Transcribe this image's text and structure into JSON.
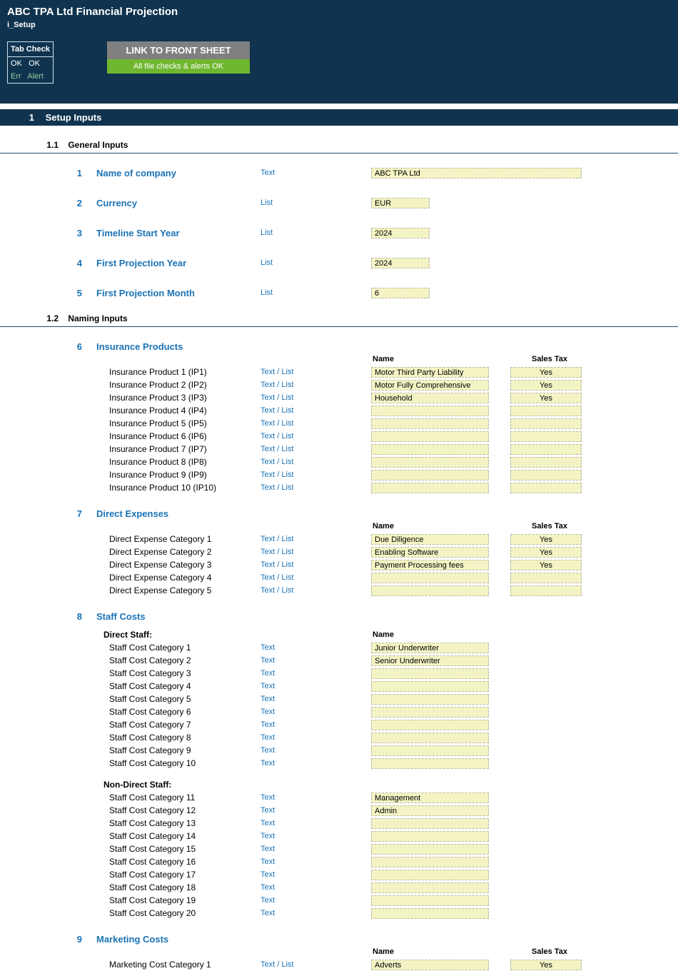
{
  "header": {
    "title": "ABC TPA Ltd Financial Projection",
    "subtitle": "i_Setup"
  },
  "tabcheck": {
    "title": "Tab Check",
    "ok1": "OK",
    "ok2": "OK",
    "err": "Err",
    "alert": "Alert"
  },
  "links": {
    "front": "LINK TO FRONT SHEET",
    "status": "All file checks & alerts OK"
  },
  "section1": {
    "num": "1",
    "title": "Setup Inputs"
  },
  "sub11": {
    "num": "1.1",
    "title": "General Inputs"
  },
  "sub12": {
    "num": "1.2",
    "title": "Naming Inputs"
  },
  "general": [
    {
      "n": "1",
      "label": "Name of company",
      "type": "Text",
      "value": "ABC TPA Ltd",
      "wide": true
    },
    {
      "n": "2",
      "label": "Currency",
      "type": "List",
      "value": "EUR"
    },
    {
      "n": "3",
      "label": "Timeline Start Year",
      "type": "List",
      "value": "2024"
    },
    {
      "n": "4",
      "label": "First Projection Year",
      "type": "List",
      "value": "2024"
    },
    {
      "n": "5",
      "label": "First Projection Month",
      "type": "List",
      "value": "6"
    }
  ],
  "headers": {
    "name": "Name",
    "salesTax": "Sales Tax"
  },
  "insurance": {
    "n": "6",
    "title": "Insurance Products",
    "rows": [
      {
        "label": "Insurance Product 1 (IP1)",
        "type": "Text / List",
        "name": "Motor Third Party Liability",
        "tax": "Yes"
      },
      {
        "label": "Insurance Product 2 (IP2)",
        "type": "Text / List",
        "name": "Motor Fully Comprehensive",
        "tax": "Yes"
      },
      {
        "label": "Insurance Product 3 (IP3)",
        "type": "Text / List",
        "name": "Household",
        "tax": "Yes"
      },
      {
        "label": "Insurance Product 4 (IP4)",
        "type": "Text / List",
        "name": "",
        "tax": ""
      },
      {
        "label": "Insurance Product 5 (IP5)",
        "type": "Text / List",
        "name": "",
        "tax": ""
      },
      {
        "label": "Insurance Product 6 (IP6)",
        "type": "Text / List",
        "name": "",
        "tax": ""
      },
      {
        "label": "Insurance Product 7 (IP7)",
        "type": "Text / List",
        "name": "",
        "tax": ""
      },
      {
        "label": "Insurance Product 8 (IP8)",
        "type": "Text / List",
        "name": "",
        "tax": ""
      },
      {
        "label": "Insurance Product 9 (IP9)",
        "type": "Text / List",
        "name": "",
        "tax": ""
      },
      {
        "label": "Insurance Product 10 (IP10)",
        "type": "Text / List",
        "name": "",
        "tax": ""
      }
    ]
  },
  "direct": {
    "n": "7",
    "title": "Direct Expenses",
    "rows": [
      {
        "label": "Direct Expense Category 1",
        "type": "Text / List",
        "name": "Due Diligence",
        "tax": "Yes"
      },
      {
        "label": "Direct Expense Category 2",
        "type": "Text / List",
        "name": "Enabling Software",
        "tax": "Yes"
      },
      {
        "label": "Direct Expense Category 3",
        "type": "Text / List",
        "name": "Payment Processing fees",
        "tax": "Yes"
      },
      {
        "label": "Direct Expense Category 4",
        "type": "Text / List",
        "name": "",
        "tax": ""
      },
      {
        "label": "Direct Expense Category 5",
        "type": "Text / List",
        "name": "",
        "tax": ""
      }
    ]
  },
  "staff": {
    "n": "8",
    "title": "Staff Costs",
    "directHead": "Direct Staff:",
    "nondirectHead": "Non-Direct Staff:",
    "directRows": [
      {
        "label": "Staff Cost Category 1",
        "type": "Text",
        "name": "Junior Underwriter"
      },
      {
        "label": "Staff Cost Category 2",
        "type": "Text",
        "name": "Senior Underwriter"
      },
      {
        "label": "Staff Cost Category 3",
        "type": "Text",
        "name": ""
      },
      {
        "label": "Staff Cost Category 4",
        "type": "Text",
        "name": ""
      },
      {
        "label": "Staff Cost Category 5",
        "type": "Text",
        "name": ""
      },
      {
        "label": "Staff Cost Category 6",
        "type": "Text",
        "name": ""
      },
      {
        "label": "Staff Cost Category 7",
        "type": "Text",
        "name": ""
      },
      {
        "label": "Staff Cost Category 8",
        "type": "Text",
        "name": ""
      },
      {
        "label": "Staff Cost Category 9",
        "type": "Text",
        "name": ""
      },
      {
        "label": "Staff Cost Category 10",
        "type": "Text",
        "name": ""
      }
    ],
    "nondirectRows": [
      {
        "label": "Staff Cost Category 11",
        "type": "Text",
        "name": "Management"
      },
      {
        "label": "Staff Cost Category 12",
        "type": "Text",
        "name": "Admin"
      },
      {
        "label": "Staff Cost Category 13",
        "type": "Text",
        "name": ""
      },
      {
        "label": "Staff Cost Category 14",
        "type": "Text",
        "name": ""
      },
      {
        "label": "Staff Cost Category 15",
        "type": "Text",
        "name": ""
      },
      {
        "label": "Staff Cost Category 16",
        "type": "Text",
        "name": ""
      },
      {
        "label": "Staff Cost Category 17",
        "type": "Text",
        "name": ""
      },
      {
        "label": "Staff Cost Category 18",
        "type": "Text",
        "name": ""
      },
      {
        "label": "Staff Cost Category 19",
        "type": "Text",
        "name": ""
      },
      {
        "label": "Staff Cost Category 20",
        "type": "Text",
        "name": ""
      }
    ]
  },
  "marketing": {
    "n": "9",
    "title": "Marketing Costs",
    "rows": [
      {
        "label": "Marketing Cost Category 1",
        "type": "Text / List",
        "name": "Adverts",
        "tax": "Yes"
      }
    ]
  }
}
